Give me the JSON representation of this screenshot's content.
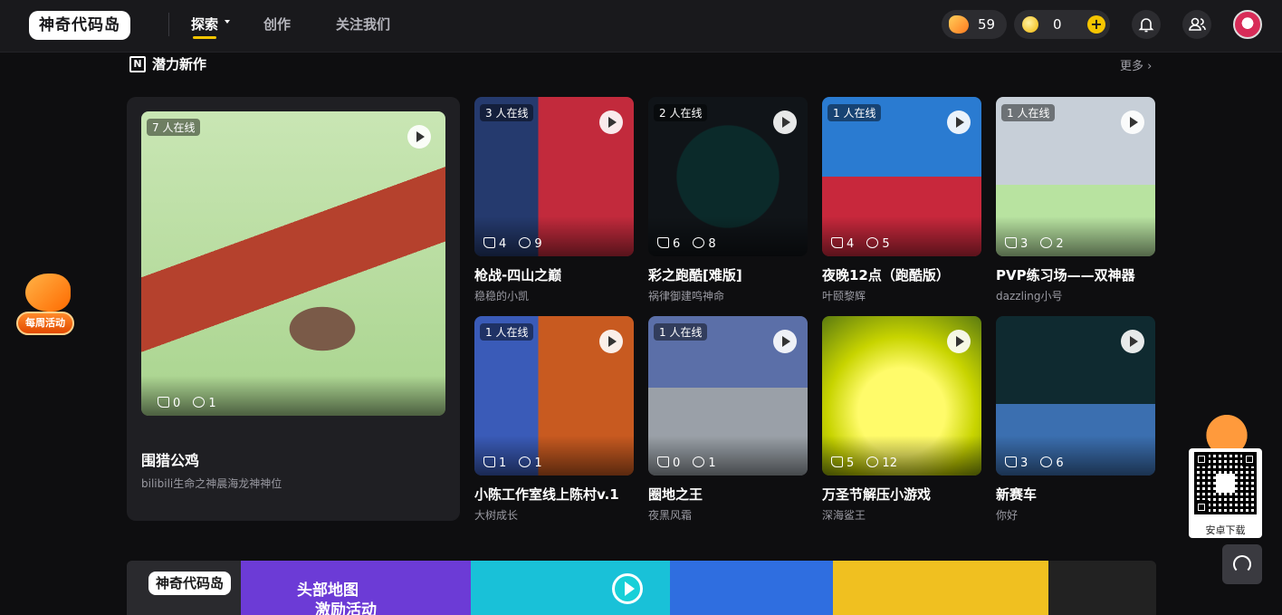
{
  "header": {
    "logo_text": "神奇代码岛",
    "nav": [
      {
        "label": "探索",
        "active": true
      },
      {
        "label": "创作",
        "active": false
      },
      {
        "label": "关注我们",
        "active": false
      }
    ],
    "gem_count": "59",
    "coin_count": "0"
  },
  "section": {
    "title": "潜力新作",
    "more_label": "更多",
    "more_chevron": "›"
  },
  "featured": {
    "online": "7 人在线",
    "likes": "0",
    "comments": "1",
    "title": "围猎公鸡",
    "author": "bilibili生命之神晨海龙神神位",
    "thumb_colors": [
      "#c9e6b4",
      "#b5412d",
      "#7a5a48"
    ]
  },
  "games": [
    {
      "online": "3 人在线",
      "likes": "4",
      "comments": "9",
      "title": "枪战-四山之巅",
      "author": "稳稳的小凯",
      "bg": "linear-gradient(90deg,#253a6e 0 40%,#c22a3c 40% 100%)"
    },
    {
      "online": "2 人在线",
      "likes": "6",
      "comments": "8",
      "title": "彩之跑酷[难版]",
      "author": "祸律御建鸣神命",
      "bg": "radial-gradient(circle,#0b2a2a 0 45%,#101418 46%)"
    },
    {
      "online": "1 人在线",
      "likes": "4",
      "comments": "5",
      "title": "夜晚12点（跑酷版）",
      "author": "叶颐黎辉",
      "bg": "linear-gradient(180deg,#2a7bd1 0 50%,#c8283c 50% 100%)"
    },
    {
      "online": "1 人在线",
      "likes": "3",
      "comments": "2",
      "title": "PVP练习场——双神器",
      "author": "dazzling小号",
      "bg": "linear-gradient(180deg,#c7cfd8 0 55%,#b8e3a0 55% 100%)"
    },
    {
      "online": "1 人在线",
      "likes": "1",
      "comments": "1",
      "title": "小陈工作室线上陈村v.1",
      "author": "大树成长",
      "bg": "linear-gradient(90deg,#3a5bb8 0 40%,#c85a20 40% 100%)"
    },
    {
      "online": "1 人在线",
      "likes": "0",
      "comments": "1",
      "title": "圈地之王",
      "author": "夜黑风霜",
      "bg": "linear-gradient(180deg,#5b6fa8 0 45%,#9aa0a8 45% 100%)"
    },
    {
      "online": "",
      "likes": "5",
      "comments": "12",
      "title": "万圣节解压小游戏",
      "author": "深海鲨王",
      "bg": "radial-gradient(circle at 50% 60%,#fffb6a 0 35%,#c8d400 60%,#5a7a10 100%)"
    },
    {
      "online": "",
      "likes": "3",
      "comments": "6",
      "title": "新赛车",
      "author": "你好",
      "bg": "linear-gradient(180deg,#0f2a30 0 55%,#3b6fb0 55% 100%)"
    }
  ],
  "weekly_label": "每周活动",
  "qr_label": "安卓下载",
  "banner": {
    "logo_text": "神奇代码岛",
    "line1": "头部地图",
    "line2": "激励活动"
  }
}
